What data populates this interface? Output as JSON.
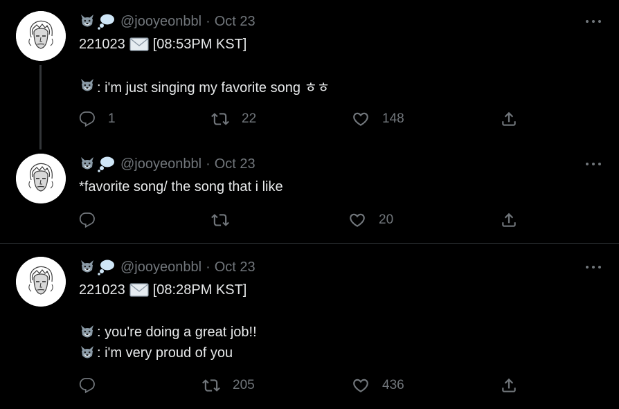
{
  "tweets": [
    {
      "handle": "@jooyeonbbl",
      "separator": "·",
      "date": "Oct 23",
      "line1_date": "221023",
      "line1_time": "[08:53PM KST]",
      "line2": ": i'm just singing my favorite song ㅎㅎ",
      "actions": {
        "replies": "1",
        "retweets": "22",
        "likes": "148"
      }
    },
    {
      "handle": "@jooyeonbbl",
      "separator": "·",
      "date": "Oct 23",
      "line1": "*favorite song/ the song that i like",
      "actions": {
        "replies": "",
        "retweets": "",
        "likes": "20"
      }
    },
    {
      "handle": "@jooyeonbbl",
      "separator": "·",
      "date": "Oct 23",
      "line1_date": "221023",
      "line1_time": "[08:28PM KST]",
      "line2": ": you're doing a great job!!",
      "line3": ": i'm very proud of you",
      "actions": {
        "replies": "",
        "retweets": "205",
        "likes": "436"
      }
    }
  ],
  "icons": {
    "name_emojis": [
      "wolf-emoji-icon",
      "thought-bubble-icon"
    ],
    "inline_emoji": "wolf-emoji-icon",
    "mail": "envelope-icon",
    "reply": "reply-icon",
    "retweet": "retweet-icon",
    "like": "heart-icon",
    "share": "share-icon",
    "more": "more-icon"
  },
  "colors": {
    "background": "#000000",
    "text": "#e7e9ea",
    "secondary": "#71767b",
    "divider": "#2f3336"
  }
}
